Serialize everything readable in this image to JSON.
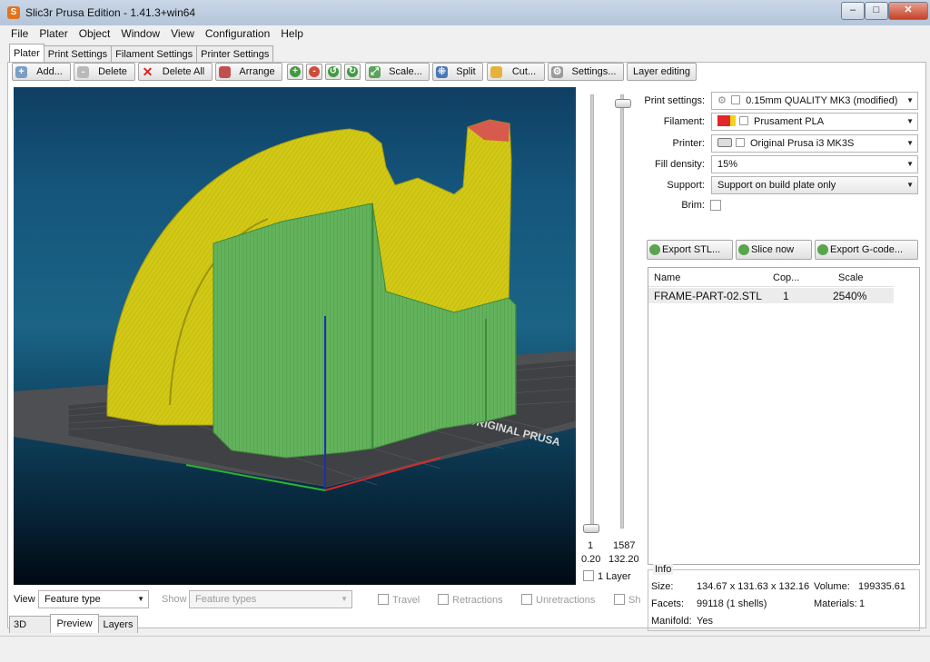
{
  "window": {
    "title": "Slic3r Prusa Edition - 1.41.3+win64",
    "app_icon_letter": "S",
    "min": "–",
    "max": "□",
    "close": "✕"
  },
  "menu": [
    "File",
    "Plater",
    "Object",
    "Window",
    "View",
    "Configuration",
    "Help"
  ],
  "tabs": [
    "Plater",
    "Print Settings",
    "Filament Settings",
    "Printer Settings"
  ],
  "toolbar": {
    "add": "Add...",
    "delete": "Delete",
    "delete_all": "Delete All",
    "arrange": "Arrange",
    "scale": "Scale...",
    "split": "Split",
    "cut": "Cut...",
    "settings": "Settings...",
    "layer_editing": "Layer editing"
  },
  "settings": {
    "print_label": "Print settings:",
    "print_value": "0.15mm QUALITY MK3 (modified)",
    "filament_label": "Filament:",
    "filament_value": "Prusament PLA",
    "printer_label": "Printer:",
    "printer_value": "Original Prusa i3 MK3S",
    "fill_label": "Fill density:",
    "fill_value": "15%",
    "support_label": "Support:",
    "support_value": "Support on build plate only",
    "brim_label": "Brim:"
  },
  "actions": {
    "export_stl": "Export STL...",
    "slice_now": "Slice now",
    "export_gcode": "Export G-code..."
  },
  "object_list": {
    "headers": [
      "Name",
      "Cop...",
      "Scale"
    ],
    "rows": [
      {
        "name": "FRAME-PART-02.STL",
        "copies": "1",
        "scale": "2540%"
      }
    ]
  },
  "info": {
    "title": "Info",
    "size_label": "Size:",
    "size_value": "134.67 x 131.63 x 132.16",
    "volume_label": "Volume:",
    "volume_value": "199335.61",
    "facets_label": "Facets:",
    "facets_value": "99118 (1 shells)",
    "materials_label": "Materials:",
    "materials_value": "1",
    "manifold_label": "Manifold:",
    "manifold_value": "Yes"
  },
  "slider": {
    "low_layer": "1",
    "high_layer": "1587",
    "low_height": "0.20",
    "high_height": "132.20",
    "one_layer_label": "1 Layer"
  },
  "bottom": {
    "view_label": "View",
    "view_value": "Feature type",
    "show_label": "Show",
    "show_value": "Feature types",
    "travel": "Travel",
    "retractions": "Retractions",
    "unretractions": "Unretractions",
    "shells": "Sh"
  },
  "view_tabs": [
    "3D",
    "Preview",
    "Layers"
  ],
  "bed_label": "ORIGINAL PRUSA",
  "colors": {
    "filament_red": "#e3262a",
    "filament_yellow": "#f3d21a",
    "model_yellow": "#d2c916",
    "model_green": "#63b25c"
  }
}
